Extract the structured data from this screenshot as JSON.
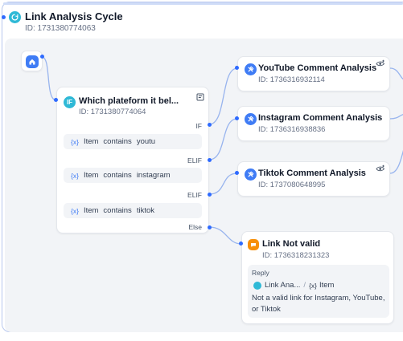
{
  "workflow": {
    "title": "Link Analysis Cycle",
    "id": "ID: 1731380774063"
  },
  "if_node": {
    "title": "Which plateform it bel...",
    "id": "ID: 1731380774064",
    "branches": [
      {
        "label": "IF",
        "var": "Item",
        "operator": "contains",
        "value": "youtu"
      },
      {
        "label": "ELIF",
        "var": "Item",
        "operator": "contains",
        "value": "instagram"
      },
      {
        "label": "ELIF",
        "var": "Item",
        "operator": "contains",
        "value": "tiktok"
      }
    ],
    "else_label": "Else"
  },
  "llm_nodes": [
    {
      "title": "YouTube Comment Analysis",
      "id": "ID: 1736316932114"
    },
    {
      "title": "Instagram Comment Analysis",
      "id": "ID: 1736316938836"
    },
    {
      "title": "Tiktok Comment Analysis",
      "id": "ID: 1737080648995"
    }
  ],
  "answer_node": {
    "title": "Link Not valid",
    "id": "ID: 1736318231323",
    "reply_label": "Reply",
    "reply_var_node": "Link Ana...",
    "reply_var_name": "Item",
    "reply_text": "Not a valid link for Instagram, YouTube, or Tiktok"
  },
  "colors": {
    "accent": "#3f7cf5",
    "wire": "#98b4ee",
    "canvas": "#f2f4f7",
    "answer": "#f79009"
  }
}
